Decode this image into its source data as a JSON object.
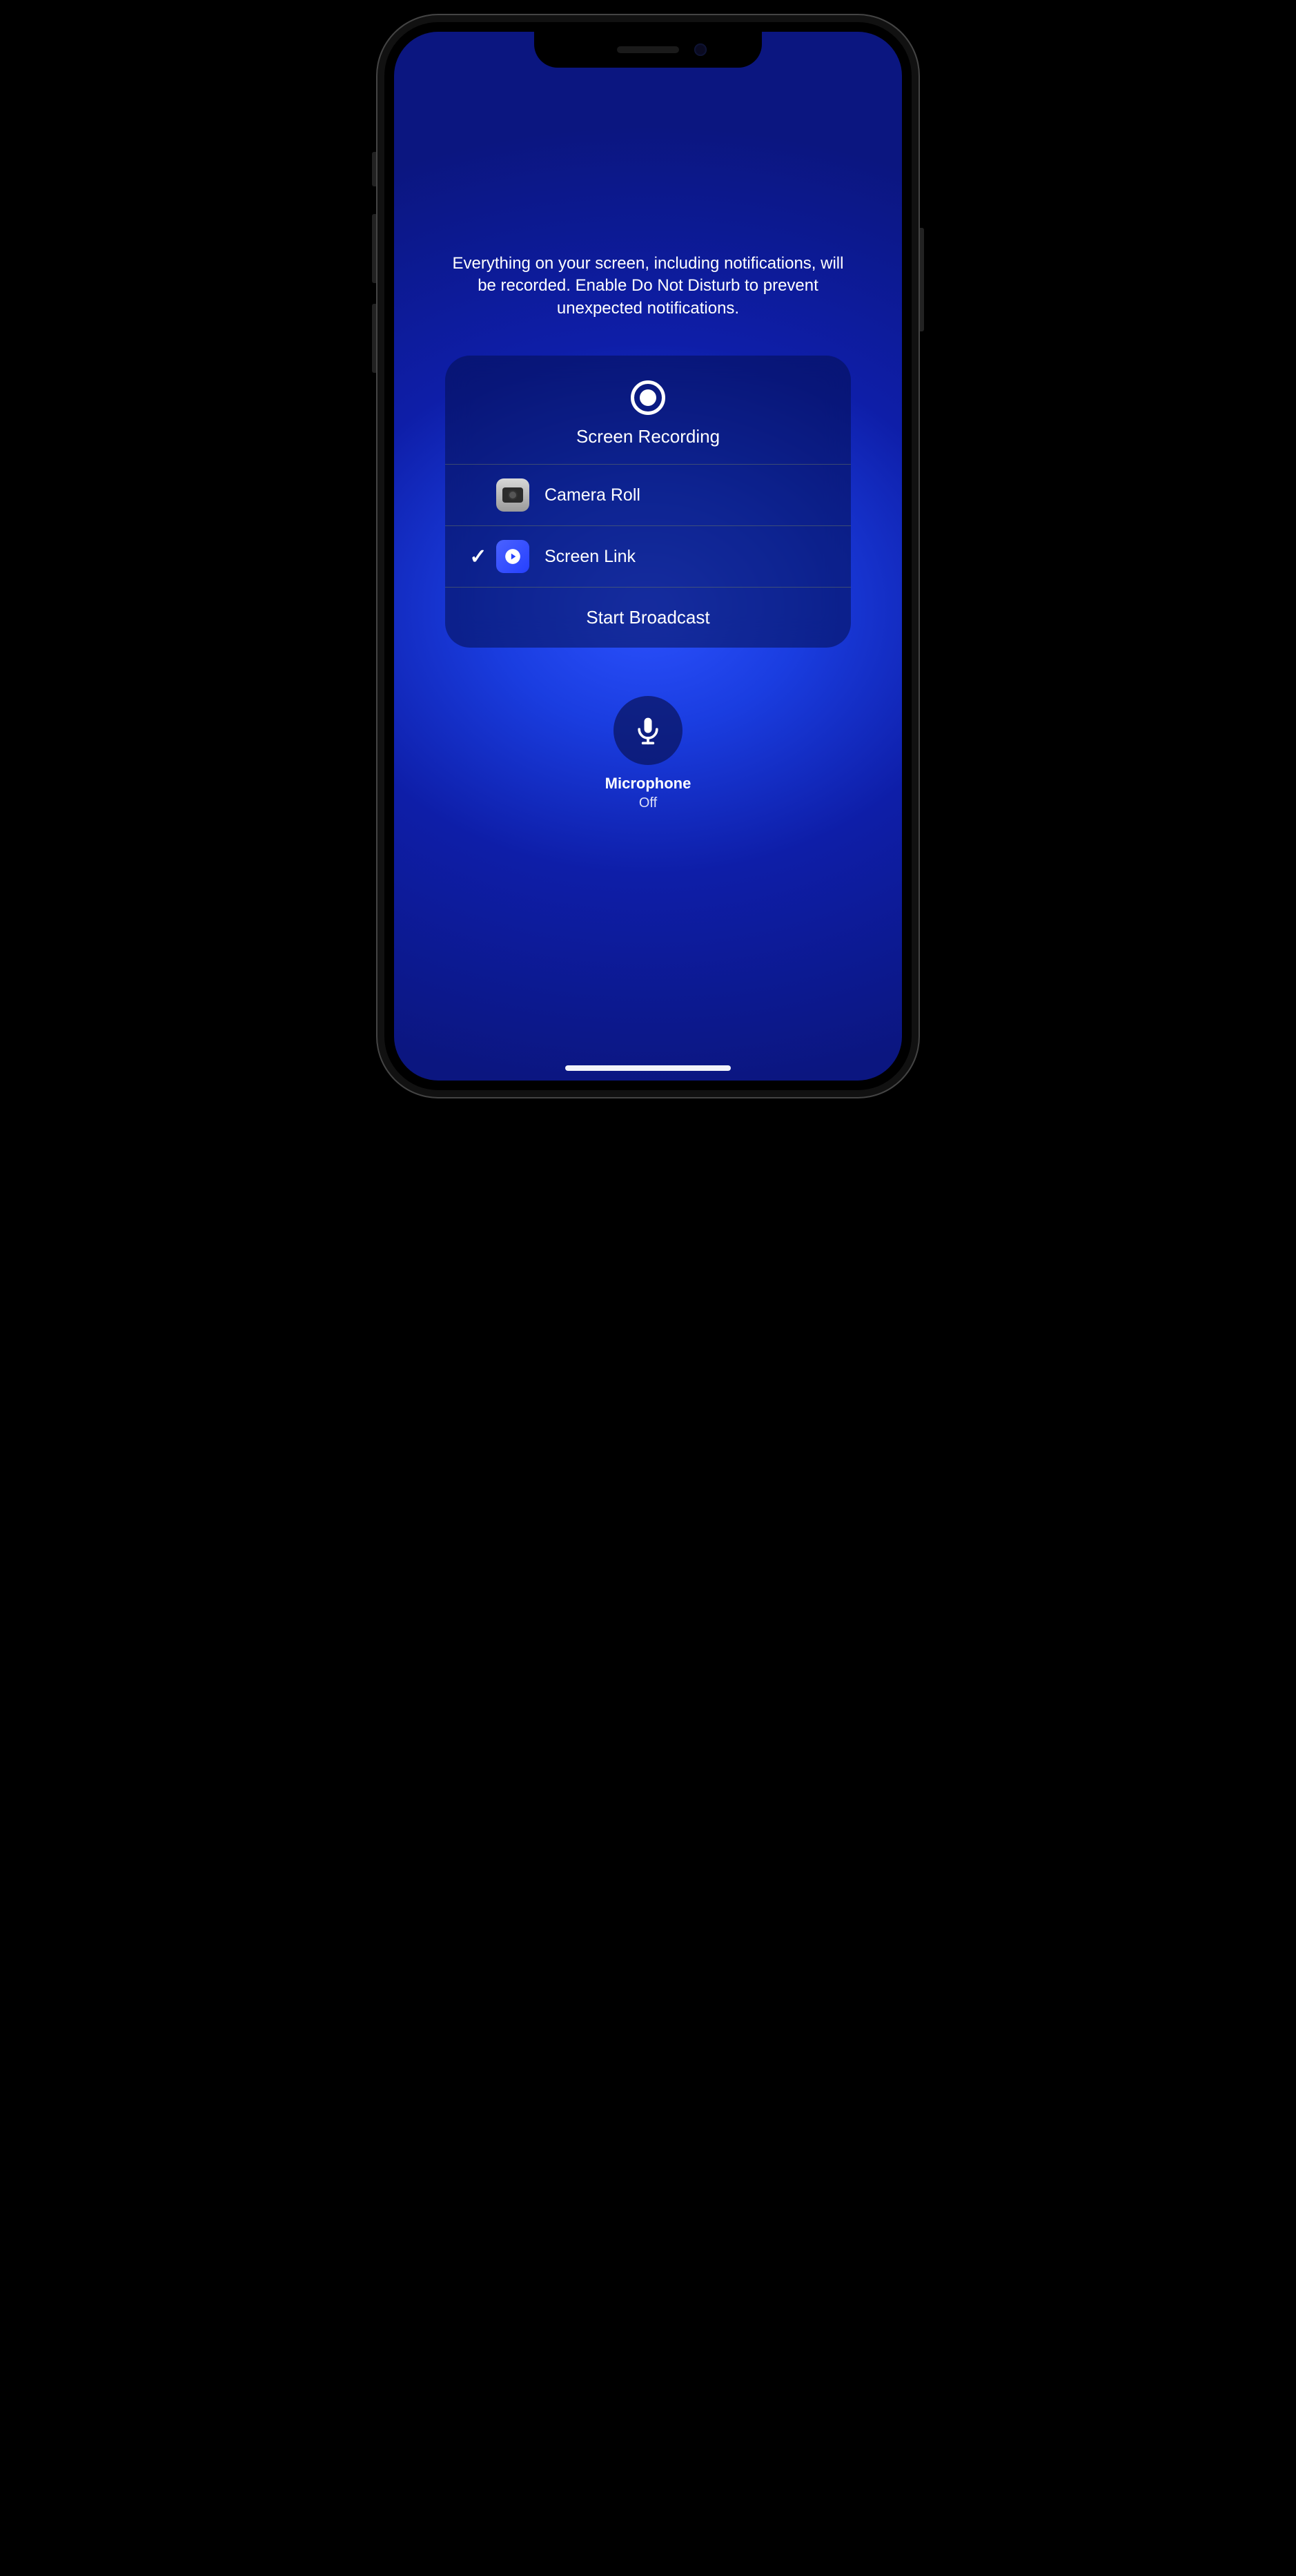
{
  "warning_text": "Everything on your screen, including notifications, will be recorded. Enable Do Not Disturb to prevent unexpected notifications.",
  "panel": {
    "title": "Screen Recording",
    "options": [
      {
        "label": "Camera Roll",
        "selected": false,
        "icon": "camera-icon"
      },
      {
        "label": "Screen Link",
        "selected": true,
        "icon": "play-icon"
      }
    ],
    "action_label": "Start Broadcast"
  },
  "microphone": {
    "label": "Microphone",
    "status": "Off"
  }
}
